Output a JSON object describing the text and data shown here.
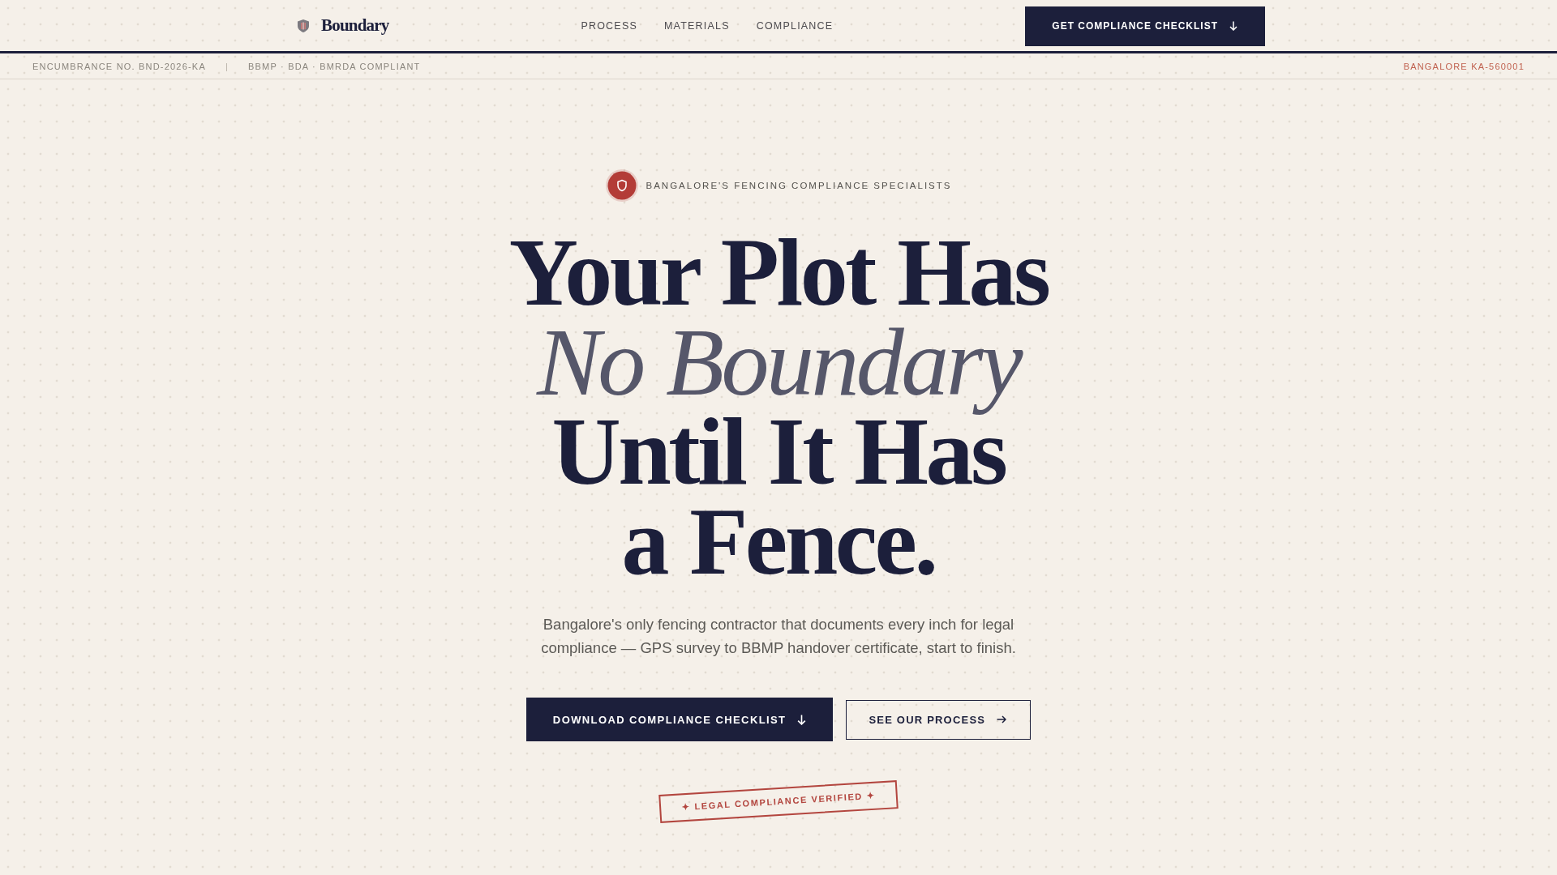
{
  "nav": {
    "logo": "Boundary",
    "links": [
      "PROCESS",
      "MATERIALS",
      "COMPLIANCE"
    ],
    "cta": "GET COMPLIANCE CHECKLIST"
  },
  "info_bar": {
    "items": [
      "ENCUMBRANCE NO. BND-2026-KA",
      "BBMP · BDA · BMRDA COMPLIANT"
    ],
    "separator": "|",
    "location": "BANGALORE KA-560001"
  },
  "hero": {
    "badge": "BANGALORE'S FENCING COMPLIANCE SPECIALISTS",
    "headline": [
      {
        "text": "Your Plot Has",
        "kind": "plain"
      },
      {
        "text": "No Boundary",
        "kind": "italic"
      },
      {
        "text": "Until It Has",
        "kind": "plain"
      },
      {
        "text": "a Fence.",
        "kind": "plain"
      }
    ],
    "description": "Bangalore's only fencing contractor that documents every inch for legal compliance — GPS survey to BBMP handover certificate, start to finish.",
    "buttons": [
      {
        "label": "DOWNLOAD COMPLIANCE CHECKLIST",
        "kind": "primary"
      },
      {
        "label": "SEE OUR PROCESS",
        "kind": "secondary"
      }
    ],
    "stamp": "✦ LEGAL COMPLIANCE VERIFIED ✦"
  }
}
